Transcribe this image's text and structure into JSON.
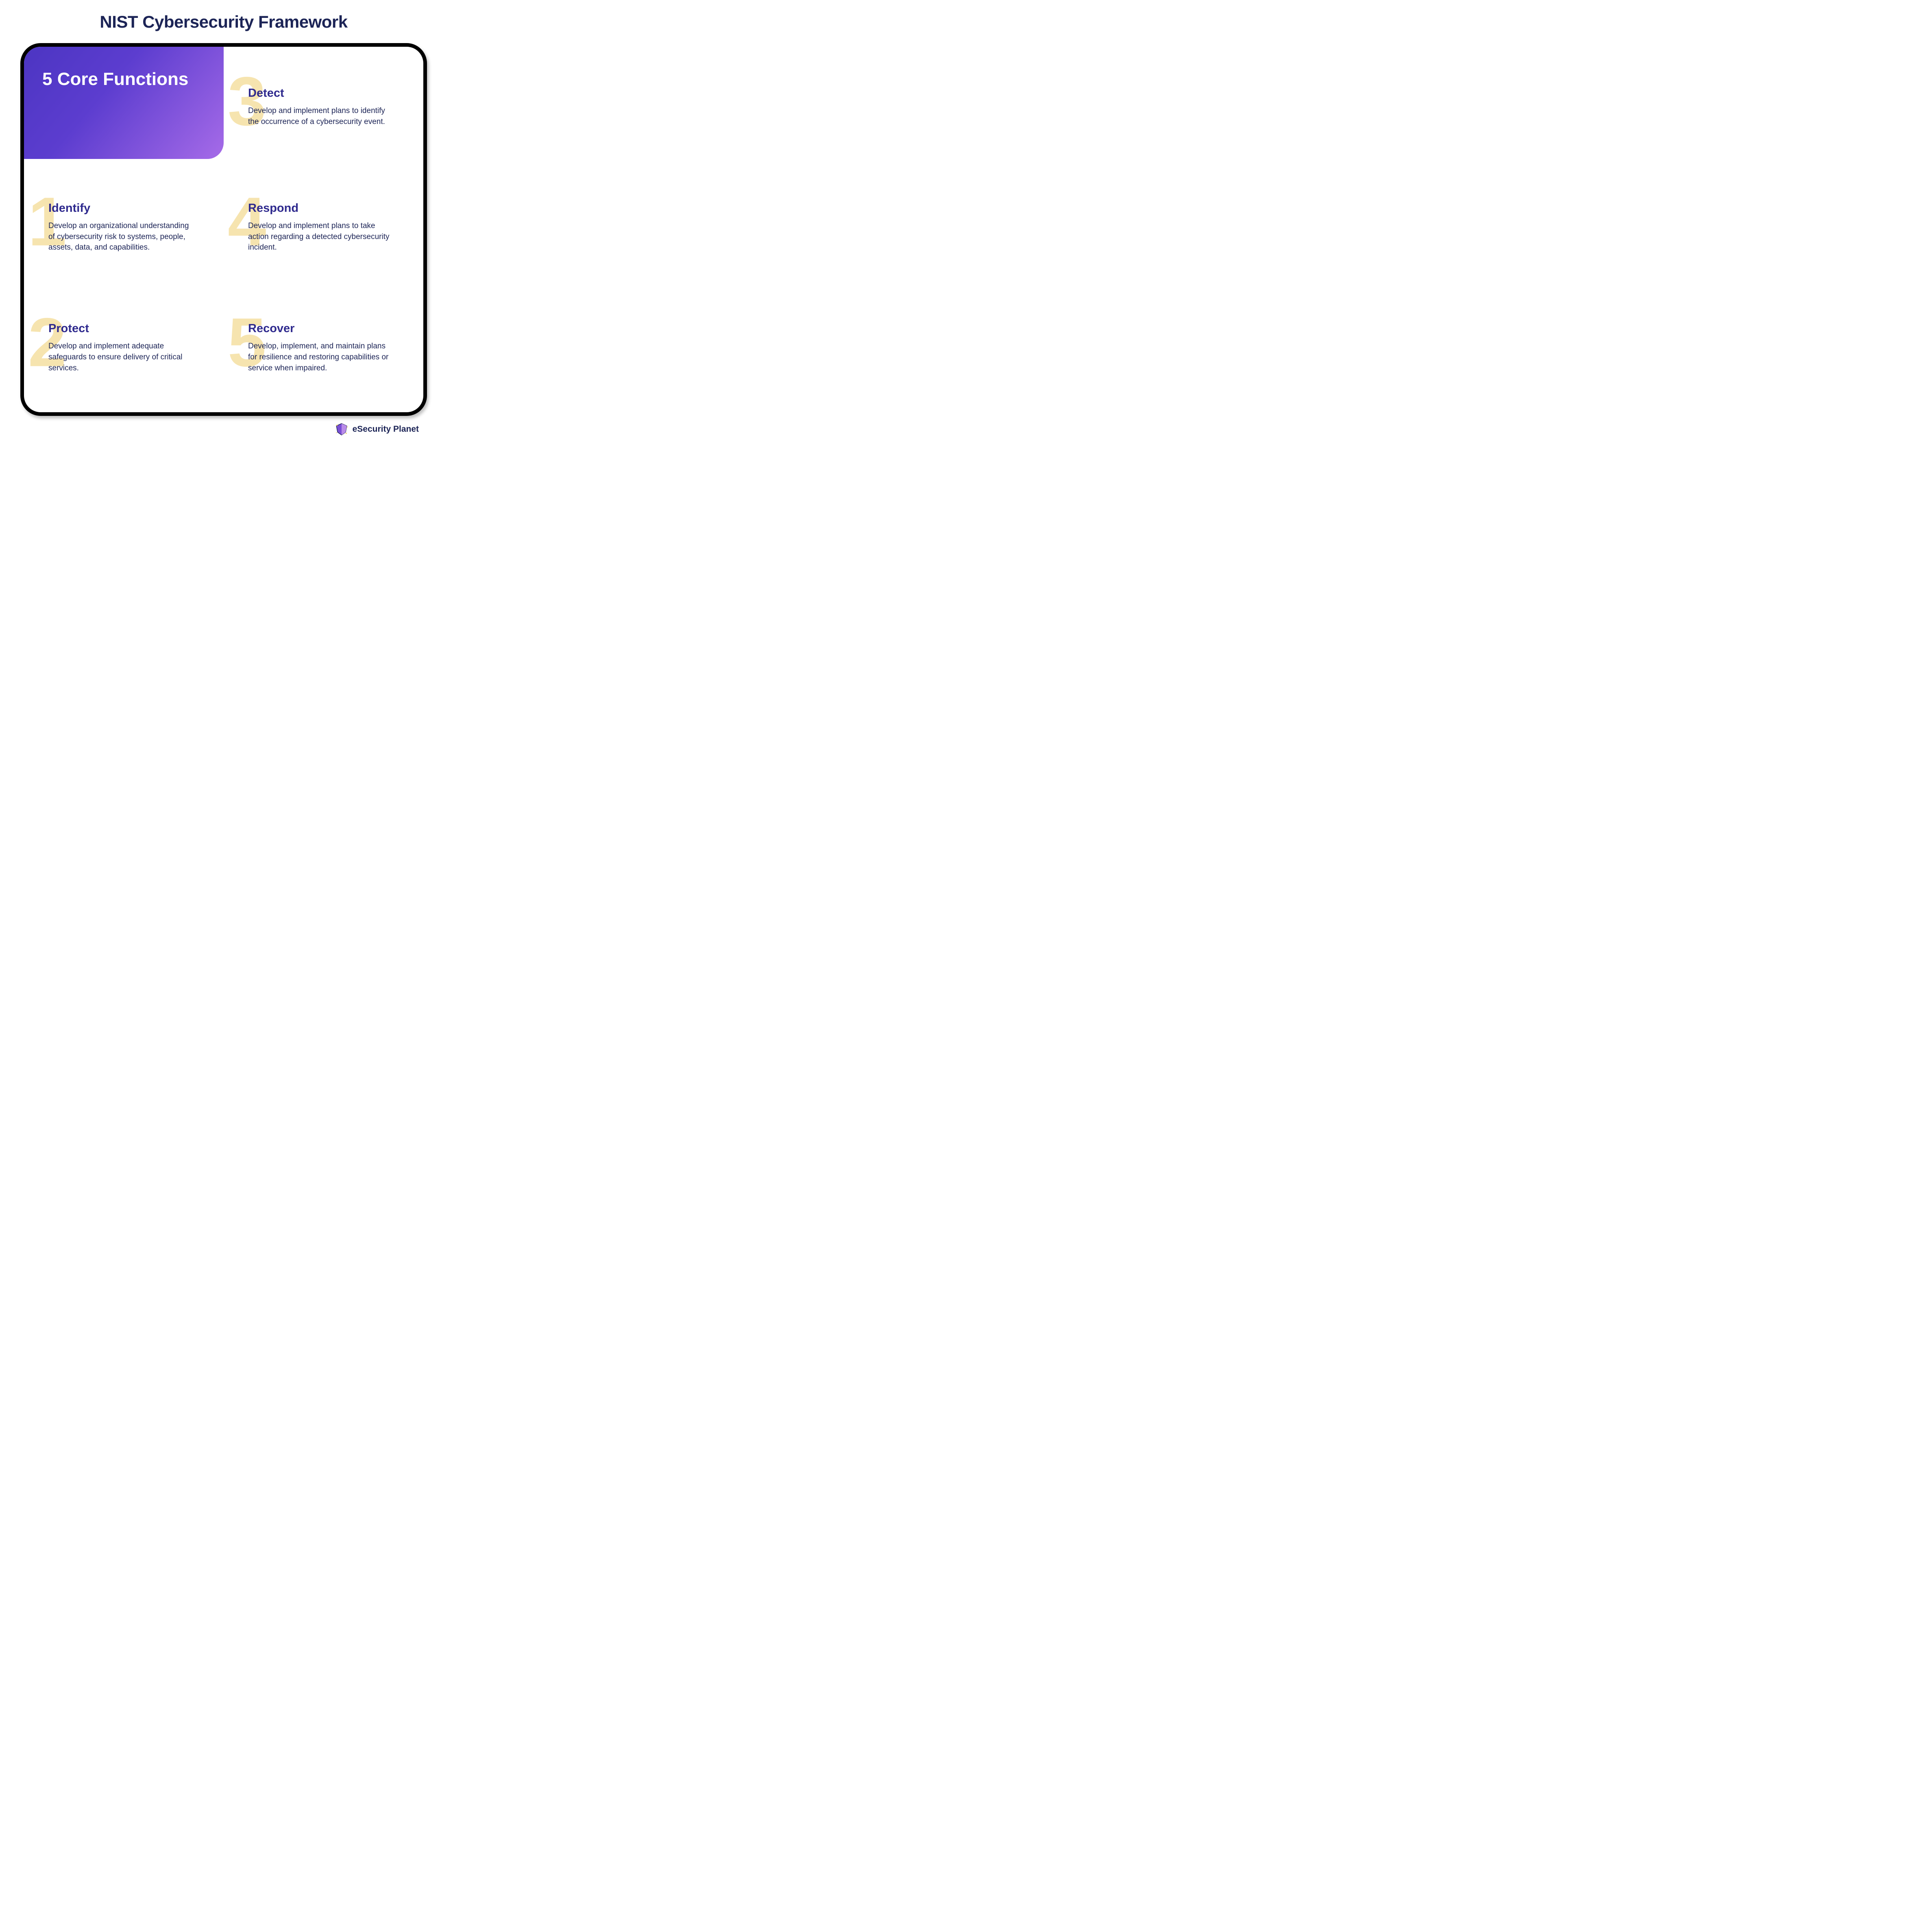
{
  "title": "NIST Cybersecurity Framework",
  "hero": "5 Core Functions",
  "functions": [
    {
      "num": "1",
      "name": "Identify",
      "desc": "Develop an organizational understanding of cybersecurity risk to systems, people, assets, data, and capabilities."
    },
    {
      "num": "2",
      "name": "Protect",
      "desc": "Develop and implement adequate safeguards to ensure delivery of critical services."
    },
    {
      "num": "3",
      "name": "Detect",
      "desc": "Develop and implement plans to identify the occurrence of a cybersecurity event."
    },
    {
      "num": "4",
      "name": "Respond",
      "desc": "Develop and implement plans to take action regarding a detected cybersecurity incident."
    },
    {
      "num": "5",
      "name": "Recover",
      "desc": "Develop, implement, and maintain plans for resilience and restoring capabilities or service when impaired."
    }
  ],
  "brand": "eSecurity Planet"
}
